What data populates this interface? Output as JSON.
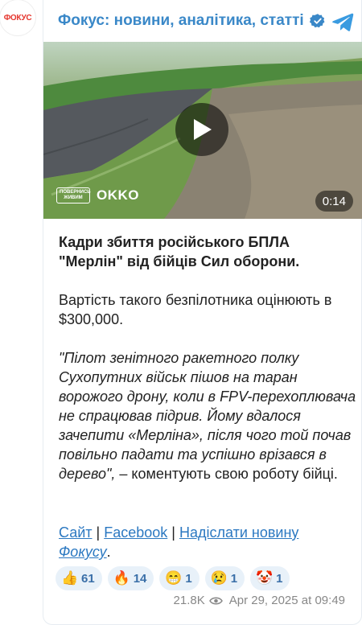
{
  "avatar": {
    "label": "ФОКУС"
  },
  "header": {
    "channel_name": "Фокус: новини, аналітика, статті"
  },
  "video": {
    "duration": "0:14",
    "watermark_badge": "ПОВЕРНИСЬ ЖИВИМ",
    "watermark_logo": "OKKO"
  },
  "post": {
    "headline": "Кадри збиття російського БПЛА \"Мерлін\" від бійців Сил оборони.",
    "price": "Вартість такого безпілотника оцінюють в $300,000.",
    "quote": "\"Пілот зенітного ракетного полку Сухопутних військ пішов на таран ворожого дрону, коли в FPV-перехоплювача не спрацював підрив. Йому вдалося зачепити «Мерліна», після чого той почав повільно падати та успішно врізався в дерево\",",
    "quote_tail": " – коментують свою роботу бійці."
  },
  "links": {
    "site": "Сайт",
    "sep1": " | ",
    "facebook": "Facebook",
    "sep2": " | ",
    "submit": "Надіслати новину",
    "fokusu": "Фокусу",
    "end": "."
  },
  "reactions": [
    {
      "emoji": "👍",
      "icon": "thumbs-up",
      "count": "61"
    },
    {
      "emoji": "🔥",
      "icon": "fire",
      "count": "14"
    },
    {
      "emoji": "😁",
      "icon": "grin",
      "count": "1"
    },
    {
      "emoji": "😢",
      "icon": "sad",
      "count": "1"
    },
    {
      "emoji": "🤡",
      "icon": "clown",
      "count": "1"
    }
  ],
  "meta": {
    "views": "21.8K",
    "date": "Apr 29, 2025 at 09:49"
  },
  "colors": {
    "accent": "#3a88c8",
    "link": "#2b78c1",
    "reaction_bg": "#e8f1f9"
  }
}
